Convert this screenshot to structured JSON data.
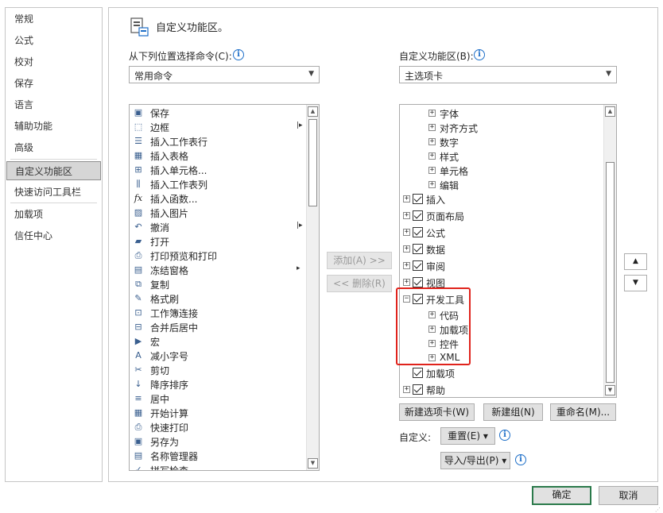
{
  "nav": {
    "items": [
      {
        "label": "常规"
      },
      {
        "label": "公式"
      },
      {
        "label": "校对"
      },
      {
        "label": "保存"
      },
      {
        "label": "语言"
      },
      {
        "label": "辅助功能"
      },
      {
        "label": "高级"
      },
      {
        "label": "自定义功能区",
        "selected": true
      },
      {
        "label": "快速访问工具栏"
      },
      {
        "label": "加载项"
      },
      {
        "label": "信任中心"
      }
    ]
  },
  "header": {
    "title": "自定义功能区。"
  },
  "left_panel": {
    "choose_label": "从下列位置选择命令(C):",
    "choose_value": "常用命令",
    "commands": [
      {
        "label": "保存",
        "icon": "save-icon",
        "glyph": "▣"
      },
      {
        "label": "边框",
        "icon": "border-icon",
        "glyph": "⬚",
        "has_sub": true
      },
      {
        "label": "插入工作表行",
        "icon": "insert-row-icon",
        "glyph": "☰"
      },
      {
        "label": "插入表格",
        "icon": "insert-table-icon",
        "glyph": "▦"
      },
      {
        "label": "插入单元格...",
        "icon": "insert-cell-icon",
        "glyph": "⊞"
      },
      {
        "label": "插入工作表列",
        "icon": "insert-column-icon",
        "glyph": "⫼"
      },
      {
        "label": "插入函数...",
        "icon": "function-icon",
        "glyph": "fx"
      },
      {
        "label": "插入图片",
        "icon": "picture-icon",
        "glyph": "▨"
      },
      {
        "label": "撤消",
        "icon": "undo-icon",
        "glyph": "↶",
        "has_sub": true
      },
      {
        "label": "打开",
        "icon": "folder-open-icon",
        "glyph": "▰"
      },
      {
        "label": "打印预览和打印",
        "icon": "print-preview-icon",
        "glyph": "⎙"
      },
      {
        "label": "冻结窗格",
        "icon": "freeze-panes-icon",
        "glyph": "▤",
        "has_sub": true
      },
      {
        "label": "复制",
        "icon": "copy-icon",
        "glyph": "⧉"
      },
      {
        "label": "格式刷",
        "icon": "format-painter-icon",
        "glyph": "✎"
      },
      {
        "label": "工作簿连接",
        "icon": "connections-icon",
        "glyph": "⊡"
      },
      {
        "label": "合并后居中",
        "icon": "merge-center-icon",
        "glyph": "⊟"
      },
      {
        "label": "宏",
        "icon": "macro-icon",
        "glyph": "▶"
      },
      {
        "label": "减小字号",
        "icon": "decrease-font-icon",
        "glyph": "A"
      },
      {
        "label": "剪切",
        "icon": "cut-icon",
        "glyph": "✂"
      },
      {
        "label": "降序排序",
        "icon": "sort-desc-icon",
        "glyph": "↓"
      },
      {
        "label": "居中",
        "icon": "align-center-icon",
        "glyph": "≡"
      },
      {
        "label": "开始计算",
        "icon": "calculate-icon",
        "glyph": "▦"
      },
      {
        "label": "快速打印",
        "icon": "quick-print-icon",
        "glyph": "⎙"
      },
      {
        "label": "另存为",
        "icon": "save-as-icon",
        "glyph": "▣"
      },
      {
        "label": "名称管理器",
        "icon": "name-manager-icon",
        "glyph": "▤"
      },
      {
        "label": "拼写检查",
        "icon": "spelling-icon",
        "glyph": "✓"
      }
    ]
  },
  "middle": {
    "add_label": "添加(A) >>",
    "remove_label": "<< 删除(R)"
  },
  "right_panel": {
    "customize_label": "自定义功能区(B):",
    "customize_value": "主选项卡",
    "tree": [
      {
        "label": "字体",
        "level": 2,
        "expander": "+"
      },
      {
        "label": "对齐方式",
        "level": 2,
        "expander": "+"
      },
      {
        "label": "数字",
        "level": 2,
        "expander": "+"
      },
      {
        "label": "样式",
        "level": 2,
        "expander": "+"
      },
      {
        "label": "单元格",
        "level": 2,
        "expander": "+"
      },
      {
        "label": "编辑",
        "level": 2,
        "expander": "+"
      },
      {
        "label": "插入",
        "level": 1,
        "expander": "+",
        "checked": true
      },
      {
        "label": "页面布局",
        "level": 1,
        "expander": "+",
        "checked": true
      },
      {
        "label": "公式",
        "level": 1,
        "expander": "+",
        "checked": true
      },
      {
        "label": "数据",
        "level": 1,
        "expander": "+",
        "checked": true
      },
      {
        "label": "审阅",
        "level": 1,
        "expander": "+",
        "checked": true
      },
      {
        "label": "视图",
        "level": 1,
        "expander": "+",
        "checked": true
      },
      {
        "label": "开发工具",
        "level": 1,
        "expander": "−",
        "checked": true
      },
      {
        "label": "代码",
        "level": 2,
        "expander": "+"
      },
      {
        "label": "加载项",
        "level": 2,
        "expander": "+"
      },
      {
        "label": "控件",
        "level": 2,
        "expander": "+"
      },
      {
        "label": "XML",
        "level": 2,
        "expander": "+"
      },
      {
        "label": "加载项",
        "level": 1,
        "expander": "",
        "checked": true
      },
      {
        "label": "帮助",
        "level": 1,
        "expander": "+",
        "checked": true
      }
    ],
    "new_tab_label": "新建选项卡(W)",
    "new_group_label": "新建组(N)",
    "rename_label": "重命名(M)...",
    "customizations_label": "自定义:",
    "reset_label": "重置(E) ▾",
    "import_export_label": "导入/导出(P) ▾"
  },
  "footer": {
    "ok_label": "确定",
    "cancel_label": "取消"
  },
  "colors": {
    "highlight": "#e0231c",
    "info": "#1e6fc8",
    "ok_border": "#2b7a4b"
  }
}
